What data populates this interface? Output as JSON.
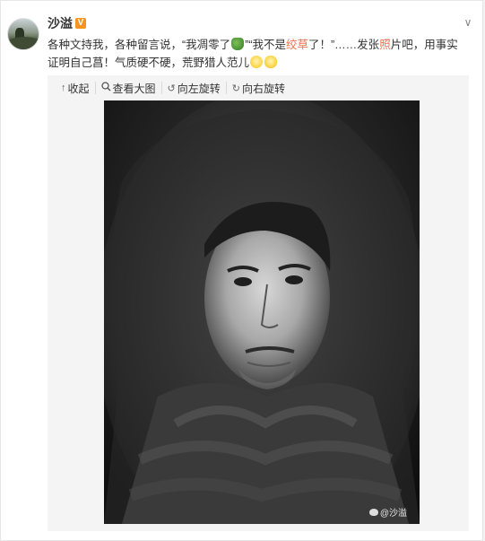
{
  "post": {
    "author": "沙溢",
    "badge": "V",
    "text": {
      "p1": "各种文持我，各种留言说，“我凋零了",
      "p2": "”“我不是",
      "p3_hl": "绞草",
      "p4": "了！”……发张",
      "p5_hl": "照",
      "p6": "片吧，用事实证明自己菖！气质硬不硬，荒野猎人范儿"
    }
  },
  "toolbar": {
    "collapse": "收起",
    "view_large": "查看大图",
    "rotate_left": "向左旋转",
    "rotate_right": "向右旋转"
  },
  "photo": {
    "watermark": "@沙溢"
  },
  "colors": {
    "highlight": "#eb7350",
    "badge": "#f7931e"
  },
  "icons": [
    "chevron-down-icon",
    "collapse-icon",
    "search-icon",
    "rotate-left-icon",
    "rotate-right-icon",
    "weibo-logo-icon"
  ]
}
